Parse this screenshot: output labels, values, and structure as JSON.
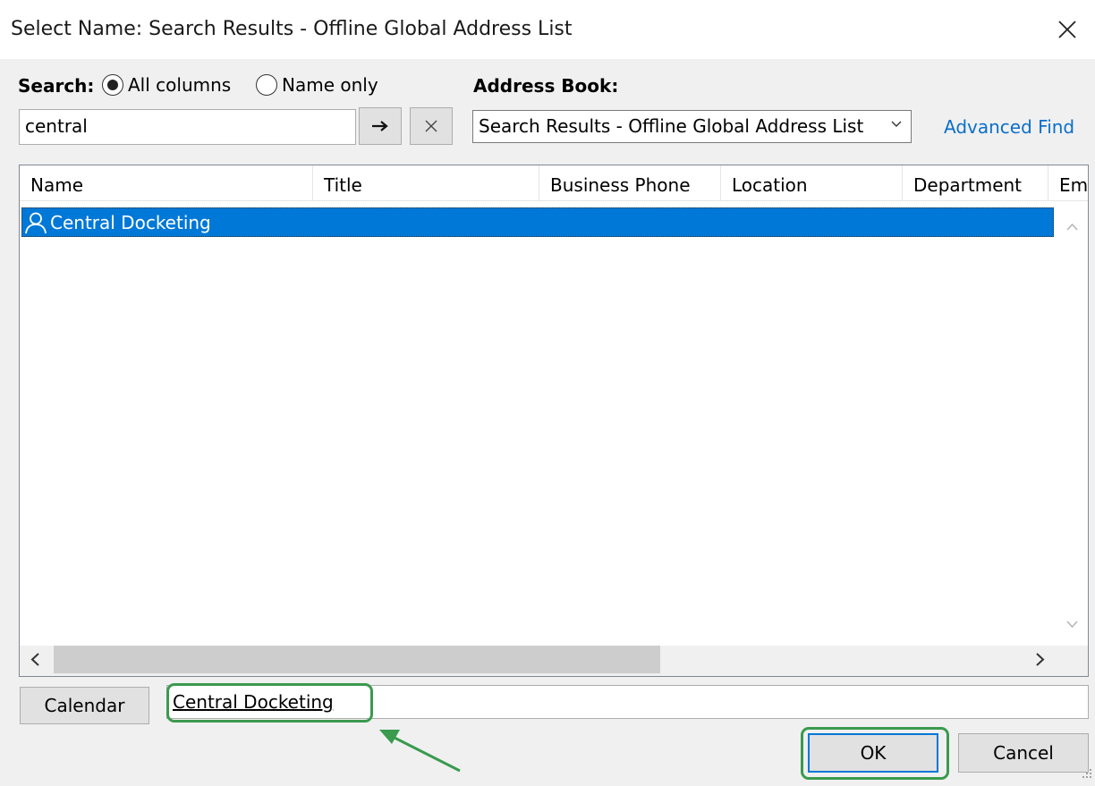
{
  "window": {
    "title": "Select Name: Search Results - Offline Global Address List",
    "close_icon": "close-icon"
  },
  "search": {
    "label": "Search:",
    "options": [
      {
        "label": "All columns",
        "selected": true
      },
      {
        "label": "Name only",
        "selected": false
      }
    ],
    "query": "central",
    "go_icon": "arrow-right-icon",
    "clear_icon": "close-icon"
  },
  "address_book": {
    "label": "Address Book:",
    "selected": "Search Results - Offline Global Address List",
    "advanced_find": "Advanced Find"
  },
  "list": {
    "columns": [
      "Name",
      "Title",
      "Business Phone",
      "Location",
      "Department",
      "Em"
    ],
    "rows": [
      {
        "name": "Central Docketing",
        "icon": "contact-icon",
        "selected": true
      }
    ]
  },
  "bottom": {
    "calendar_button": "Calendar",
    "selected_name": "Central Docketing",
    "ok_button": "OK",
    "cancel_button": "Cancel"
  },
  "annotation": {
    "highlight_color": "#3a9a4e"
  },
  "colors": {
    "selection": "#0078d7",
    "link": "#0b6fcb"
  }
}
